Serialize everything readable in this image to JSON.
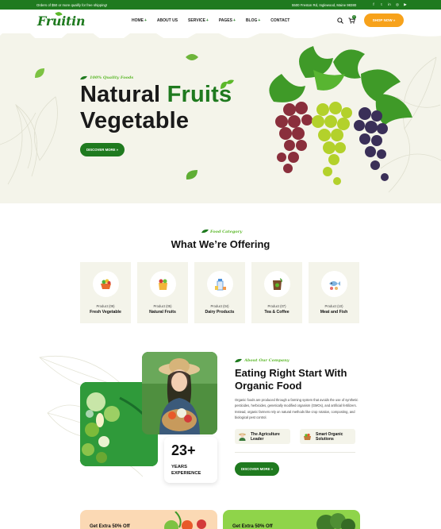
{
  "topbar": {
    "promo": "Orders of $50 or more qualify for free shipping!",
    "address": "5500 Freston Rd, Inglewood, Maine 98380",
    "social_icons": [
      "facebook-icon",
      "twitter-icon",
      "linkedin-icon",
      "instagram-icon",
      "youtube-icon"
    ]
  },
  "header": {
    "logo": "Fruitin",
    "nav": [
      {
        "label": "HOME",
        "plus": "+"
      },
      {
        "label": "ABOUT US",
        "plus": ""
      },
      {
        "label": "SERVICE",
        "plus": "+"
      },
      {
        "label": "PAGES",
        "plus": "+"
      },
      {
        "label": "BLOG",
        "plus": "+"
      },
      {
        "label": "CONTACT",
        "plus": ""
      }
    ],
    "cart_count": "0",
    "shop_button": "SHOP NOW »"
  },
  "hero": {
    "tag": "100% Quality Foods",
    "title_part1": "Natural ",
    "title_green": "Fruits",
    "title_line2": "Vegetable",
    "button": "DISCOVER MORE »"
  },
  "offering": {
    "tag": "Food Category",
    "title": "What We’re Offering",
    "categories": [
      {
        "count": "Product (09)",
        "name": "Fresh Vegetable",
        "icon": "vegetable-basket-icon"
      },
      {
        "count": "Product (05)",
        "name": "Natural Fruits",
        "icon": "fruit-bag-icon"
      },
      {
        "count": "Product (04)",
        "name": "Dairy Products",
        "icon": "milk-bottle-icon"
      },
      {
        "count": "Product (07)",
        "name": "Tea & Coffee",
        "icon": "coffee-bag-icon"
      },
      {
        "count": "Product (10)",
        "name": "Meat and Fish",
        "icon": "fish-icon"
      }
    ]
  },
  "about": {
    "tag": "About Our Company",
    "title": "Eating Right Start With Organic Food",
    "text": "Organic foods are produced through a farming system that avoids the use of synthetic pesticides, herbicides, genetically modified organism (GMOs), and artificial fertilizers. Instead, organic farmers rely on natural methods like crop rotation, composting, and biological pest control.",
    "experience_number": "23+",
    "experience_label_1": "YEARS",
    "experience_label_2": "EXPERIENCE",
    "features": [
      {
        "line1": "The Agriculture",
        "line2": "Leader",
        "icon": "farmer-icon"
      },
      {
        "line1": "Smart Organic",
        "line2": "Solutions",
        "icon": "basket-icon"
      }
    ],
    "button": "DISCOVER MORE »"
  },
  "promos": [
    {
      "text": "Get Extra 50% Off"
    },
    {
      "text": "Get Extra 50% Off"
    }
  ],
  "colors": {
    "primary_green": "#1f7a1f",
    "light_green": "#5cb82a",
    "accent_orange": "#f7a21b",
    "section_bg": "#f4f4ea"
  }
}
